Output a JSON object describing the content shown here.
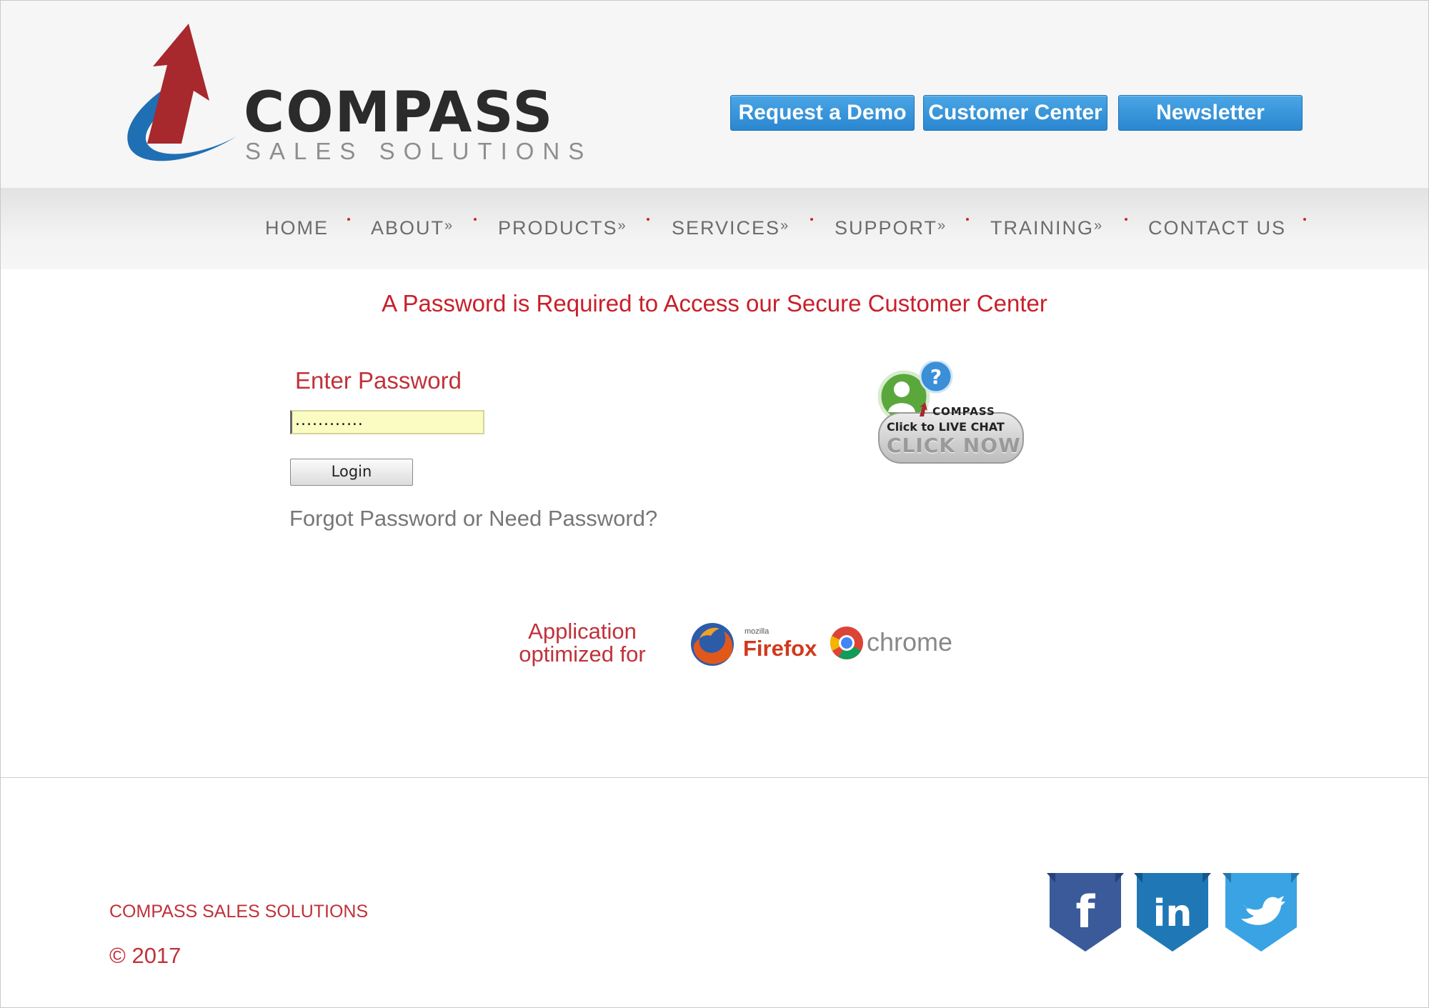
{
  "brand": {
    "name": "COMPASS",
    "tagline": "SALES SOLUTIONS",
    "colors": {
      "arrow": "#a7282d",
      "swoosh": "#1f6fb4",
      "accent": "#c8202b"
    }
  },
  "header_buttons": [
    {
      "label": "Request a Demo"
    },
    {
      "label": "Customer Center"
    },
    {
      "label": "Newsletter"
    }
  ],
  "nav": {
    "items": [
      {
        "label": "HOME",
        "submenu": ""
      },
      {
        "label": "ABOUT",
        "submenu": "»"
      },
      {
        "label": "PRODUCTS",
        "submenu": "»"
      },
      {
        "label": "SERVICES",
        "submenu": "»"
      },
      {
        "label": "SUPPORT",
        "submenu": "»"
      },
      {
        "label": "TRAINING",
        "submenu": "»"
      },
      {
        "label": "CONTACT US",
        "submenu": ""
      }
    ]
  },
  "main": {
    "notice": "A Password is Required to Access our Secure Customer Center",
    "password_label": "Enter Password",
    "password_value": "............",
    "login_label": "Login",
    "forgot_link": "Forgot Password or Need Password?"
  },
  "live_chat": {
    "brand": "COMPASS",
    "cta_line1": "Click to LIVE CHAT",
    "cta_line2": "CLICK NOW",
    "icon": "chat-help-icon"
  },
  "browsers": {
    "text_line1": "Application",
    "text_line2": "optimized for",
    "firefox_small": "mozilla",
    "firefox_name": "Firefox",
    "chrome_name": "chrome"
  },
  "footer": {
    "company": "COMPASS SALES SOLUTIONS",
    "copyright": "© 2017",
    "social": [
      {
        "icon": "facebook-icon",
        "glyph": "f"
      },
      {
        "icon": "linkedin-icon",
        "glyph": "in"
      },
      {
        "icon": "twitter-icon",
        "glyph": ""
      }
    ]
  }
}
